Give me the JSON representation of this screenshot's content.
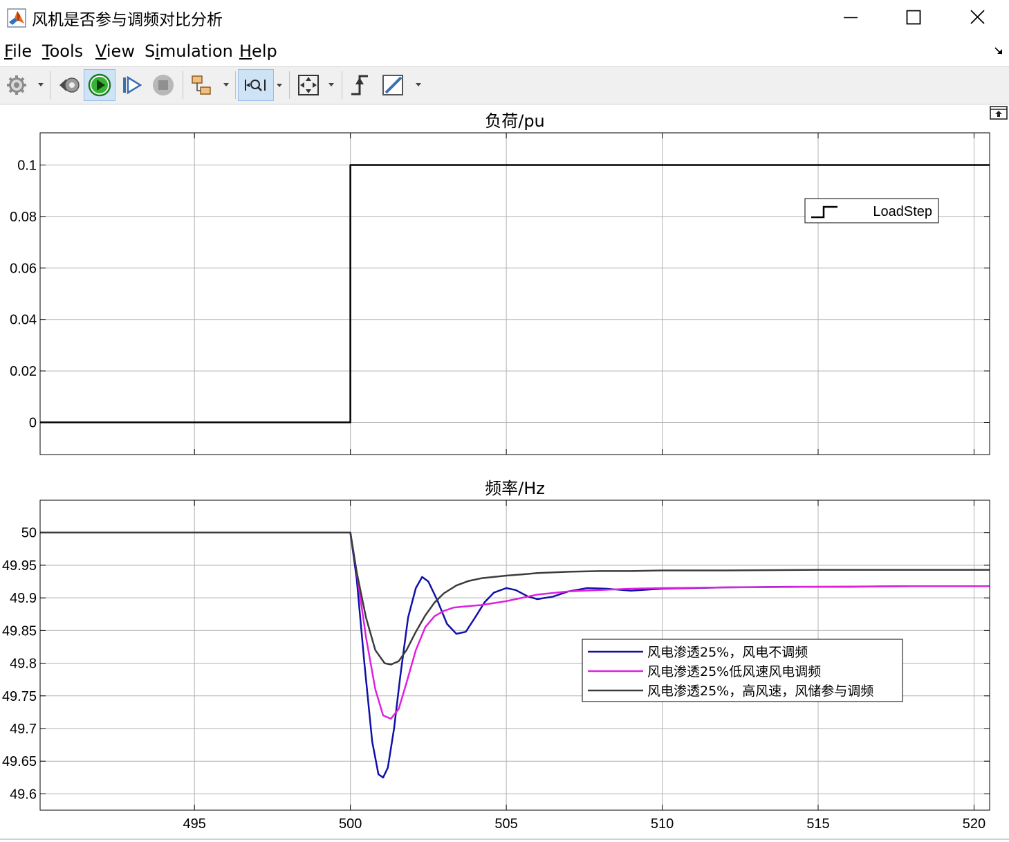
{
  "window": {
    "title": "风机是否参与调频对比分析",
    "icon": "matlab-icon",
    "controls": [
      "minimize-icon",
      "maximize-icon",
      "close-icon"
    ]
  },
  "menu": {
    "items": [
      {
        "label": "File",
        "mnemonic_index": 0
      },
      {
        "label": "Tools",
        "mnemonic_index": 0
      },
      {
        "label": "View",
        "mnemonic_index": 0
      },
      {
        "label": "Simulation",
        "mnemonic_index": 1
      },
      {
        "label": "Help",
        "mnemonic_index": 0
      }
    ],
    "expand_icon": "menu-expand-icon"
  },
  "toolbar": {
    "buttons": [
      {
        "icon": "settings-gear-icon",
        "dropdown": true,
        "active": false
      },
      {
        "icon": "step-back-icon",
        "dropdown": false,
        "active": false
      },
      {
        "icon": "run-icon",
        "dropdown": false,
        "active": true
      },
      {
        "icon": "step-forward-icon",
        "dropdown": false,
        "active": false
      },
      {
        "icon": "stop-icon",
        "dropdown": false,
        "active": false
      },
      {
        "icon": "highlight-block-icon",
        "dropdown": true,
        "active": false
      },
      {
        "icon": "zoom-x-icon",
        "dropdown": true,
        "active": true
      },
      {
        "icon": "zoom-fit-icon",
        "dropdown": true,
        "active": false
      },
      {
        "icon": "triggers-icon",
        "dropdown": false,
        "active": false
      },
      {
        "icon": "cursor-measurements-icon",
        "dropdown": true,
        "active": false
      }
    ],
    "undock_icon": "undock-icon"
  },
  "colors": {
    "loadstep": "#000000",
    "series_blue": "#1010a8",
    "series_magenta": "#e020e0",
    "series_gray": "#3c3c3c",
    "grid": "#b0b0b0",
    "axes": "#000000"
  },
  "chart_data": [
    {
      "type": "line",
      "title": "负荷/pu",
      "xlabel": "",
      "ylabel": "",
      "xlim": [
        490.05,
        520.5
      ],
      "ylim": [
        -0.0125,
        0.1125
      ],
      "xticks": [
        495,
        500,
        505,
        510,
        515,
        520
      ],
      "show_xtick_labels": false,
      "yticks": [
        0,
        0.02,
        0.04,
        0.06,
        0.08,
        0.1
      ],
      "ytick_labels": [
        "0",
        "0.02",
        "0.04",
        "0.06",
        "0.08",
        "0.1"
      ],
      "grid": true,
      "legend": {
        "placement": "upper-right",
        "style": "step-icon"
      },
      "series": [
        {
          "name": "LoadStep",
          "color": "#000000",
          "x": [
            490.05,
            500.0,
            500.0,
            520.5
          ],
          "y": [
            0,
            0,
            0.1,
            0.1
          ]
        }
      ]
    },
    {
      "type": "line",
      "title": "频率/Hz",
      "xlabel": "",
      "ylabel": "",
      "xlim": [
        490.05,
        520.5
      ],
      "ylim": [
        49.575,
        50.0495
      ],
      "xticks": [
        495,
        500,
        505,
        510,
        515,
        520
      ],
      "xtick_labels": [
        "495",
        "500",
        "505",
        "510",
        "515",
        "520"
      ],
      "yticks": [
        49.6,
        49.65,
        49.7,
        49.75,
        49.8,
        49.85,
        49.9,
        49.95,
        50
      ],
      "ytick_labels": [
        "49.6",
        "49.65",
        "49.7",
        "49.75",
        "49.8",
        "49.85",
        "49.9",
        "49.95",
        "50"
      ],
      "grid": true,
      "legend": {
        "placement": "center-right",
        "style": "line"
      },
      "series": [
        {
          "name": "风电渗透25%，风电不调频",
          "color": "#1010a8",
          "x": [
            490.05,
            500.0,
            500.2,
            500.45,
            500.7,
            500.9,
            501.05,
            501.2,
            501.4,
            501.6,
            501.85,
            502.1,
            502.3,
            502.5,
            502.8,
            503.1,
            503.4,
            503.7,
            504.0,
            504.3,
            504.6,
            505.0,
            505.3,
            505.7,
            506.0,
            506.5,
            507.0,
            507.6,
            508.2,
            509.0,
            510.0,
            511.0,
            512.0,
            514.0,
            516.0,
            518.0,
            520.5
          ],
          "y": [
            50.0,
            50.0,
            49.93,
            49.8,
            49.68,
            49.63,
            49.625,
            49.64,
            49.7,
            49.78,
            49.87,
            49.915,
            49.932,
            49.925,
            49.895,
            49.86,
            49.845,
            49.848,
            49.87,
            49.893,
            49.908,
            49.915,
            49.912,
            49.902,
            49.898,
            49.902,
            49.91,
            49.915,
            49.914,
            49.911,
            49.914,
            49.915,
            49.916,
            49.917,
            49.917,
            49.918,
            49.918
          ]
        },
        {
          "name": "风电渗透25%低风速风电调频",
          "color": "#e020e0",
          "x": [
            490.05,
            500.0,
            500.2,
            500.5,
            500.8,
            501.05,
            501.3,
            501.55,
            501.8,
            502.1,
            502.4,
            502.7,
            503.0,
            503.3,
            503.7,
            504.2,
            505.0,
            506.0,
            507.0,
            508.0,
            509.0,
            510.0,
            512.0,
            515.0,
            518.0,
            520.5
          ],
          "y": [
            50.0,
            50.0,
            49.94,
            49.84,
            49.76,
            49.72,
            49.715,
            49.73,
            49.77,
            49.82,
            49.855,
            49.872,
            49.88,
            49.885,
            49.887,
            49.889,
            49.895,
            49.905,
            49.91,
            49.912,
            49.914,
            49.915,
            49.916,
            49.917,
            49.918,
            49.918
          ]
        },
        {
          "name": "风电渗透25%，高风速，风储参与调频",
          "color": "#3c3c3c",
          "x": [
            490.05,
            500.0,
            500.2,
            500.5,
            500.8,
            501.1,
            501.3,
            501.55,
            501.8,
            502.1,
            502.4,
            502.7,
            503.0,
            503.4,
            503.8,
            504.2,
            504.6,
            505.0,
            505.5,
            506.0,
            507.0,
            508.0,
            509.0,
            510.0,
            512.0,
            515.0,
            518.0,
            520.5
          ],
          "y": [
            50.0,
            50.0,
            49.94,
            49.87,
            49.82,
            49.8,
            49.798,
            49.803,
            49.82,
            49.848,
            49.873,
            49.893,
            49.907,
            49.919,
            49.926,
            49.93,
            49.932,
            49.934,
            49.936,
            49.938,
            49.94,
            49.941,
            49.941,
            49.942,
            49.942,
            49.943,
            49.943,
            49.943
          ]
        }
      ]
    }
  ]
}
